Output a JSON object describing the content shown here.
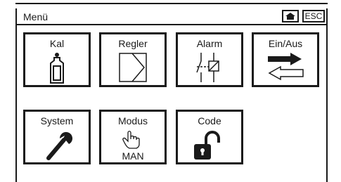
{
  "window": {
    "title": "Menü"
  },
  "header": {
    "home_icon": "home-icon",
    "esc_label": "ESC"
  },
  "tiles": [
    {
      "label": "Kal",
      "icon": "calibration-bottle-icon"
    },
    {
      "label": "Regler",
      "icon": "controller-step-icon"
    },
    {
      "label": "Alarm",
      "icon": "alarm-relay-icon"
    },
    {
      "label": "Ein/Aus",
      "icon": "in-out-arrows-icon"
    },
    {
      "label": "System",
      "icon": "wrench-icon"
    },
    {
      "label": "Modus",
      "icon": "hand-pointer-icon",
      "sub_label": "MAN"
    },
    {
      "label": "Code",
      "icon": "unlocked-padlock-icon"
    }
  ]
}
